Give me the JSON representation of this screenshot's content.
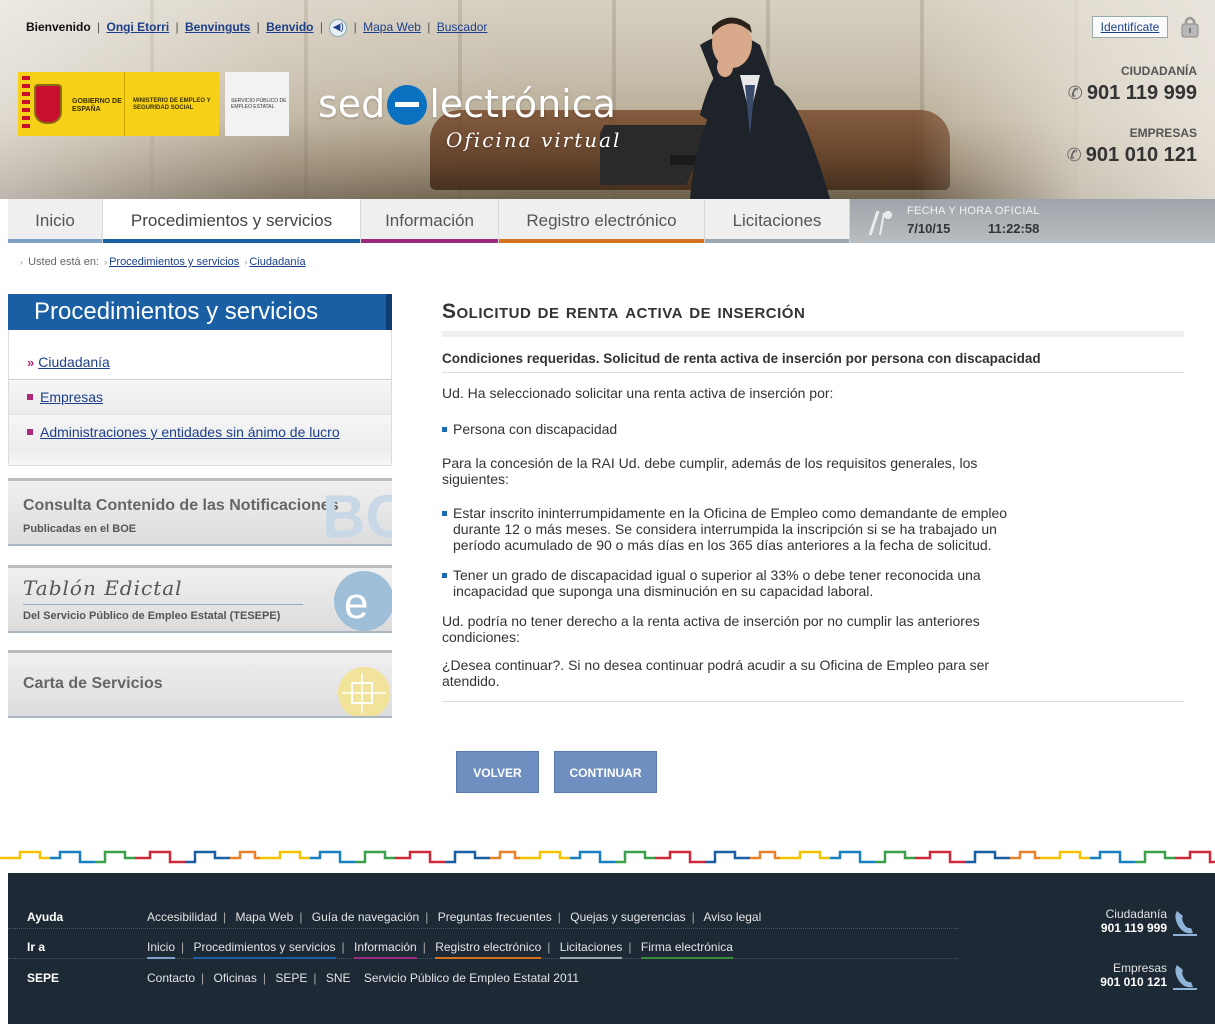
{
  "topnav": {
    "welcome": "Bienvenido",
    "langs": [
      "Ongi Etorri",
      "Benvinguts",
      "Benvido"
    ],
    "mapa": "Mapa Web",
    "buscador": "Buscador"
  },
  "logo": {
    "gobierno": "GOBIERNO DE ESPAÑA",
    "ministerio": "MINISTERIO DE EMPLEO Y SEGURIDAD SOCIAL",
    "sepe": "SERVICIO PÚBLICO DE EMPLEO ESTATAL",
    "sede_pre": "sed",
    "sede_post": "lectrónica",
    "subtitle": "Oficina virtual"
  },
  "header_right": {
    "identificate": "Identifícate",
    "ciudadania_label": "CIUDADANÍA",
    "ciudadania_phone": "901 119 999",
    "empresas_label": "EMPRESAS",
    "empresas_phone": "901 010 121"
  },
  "mainnav": {
    "tabs": [
      {
        "label": "Inicio",
        "color": "#7fa1c7"
      },
      {
        "label": "Procedimientos y servicios",
        "color": "#1a5ea4"
      },
      {
        "label": "Información",
        "color": "#9a2a7e"
      },
      {
        "label": "Registro electrónico",
        "color": "#d4711e"
      },
      {
        "label": "Licitaciones",
        "color": "#9aa6b0"
      }
    ],
    "fecha_label": "FECHA Y HORA OFICIAL",
    "fecha": "7/10/15",
    "hora": "11:22:58"
  },
  "breadcrumb": {
    "prefix": "Usted está en:",
    "items": [
      "Procedimientos y servicios",
      "Ciudadanía"
    ]
  },
  "sidebar": {
    "title": "Procedimientos y servicios",
    "items": [
      "Ciudadanía",
      "Empresas",
      "Administraciones y entidades sin ánimo de lucro"
    ],
    "boxes": {
      "notif_title": "Consulta Contenido de las Notificaciones",
      "notif_sub": "Publicadas en el BOE",
      "tablon_title": "Tablón Edictal",
      "tablon_sub": "Del Servicio Público de Empleo Estatal (TESEPE)",
      "carta_title": "Carta de Servicios"
    }
  },
  "content": {
    "title": "Solicitud de renta activa de inserción",
    "subhead": "Condiciones requeridas. Solicitud de renta activa de inserción por persona con discapacidad",
    "p1": "Ud. Ha seleccionado solicitar una renta activa de inserción por:",
    "b1": "Persona con discapacidad",
    "p2": "Para la concesión de la RAI Ud. debe cumplir, además de los requisitos generales, los siguientes:",
    "b2": "Estar inscrito ininterrumpidamente en la Oficina de Empleo como demandante de empleo durante 12 o más meses. Se considera interrumpida la inscripción si se ha trabajado un período acumulado de 90 o más días en los 365 días anteriores a la fecha de solicitud.",
    "b3": "Tener un grado de discapacidad igual o superior al 33% o debe tener reconocida una incapacidad que suponga una disminución en su capacidad laboral.",
    "p3": "Ud. podría no tener derecho a la renta activa de inserción por no cumplir las anteriores condiciones:",
    "p4": "¿Desea continuar?. Si no desea continuar podrá acudir a su Oficina de Empleo para ser atendido.",
    "btn_volver": "VOLVER",
    "btn_continuar": "CONTINUAR"
  },
  "footer": {
    "ayuda_head": "Ayuda",
    "ayuda_links": [
      "Accesibilidad",
      "Mapa Web",
      "Guía de navegación",
      "Preguntas frecuentes",
      "Quejas y sugerencias",
      "Aviso legal"
    ],
    "ira_head": "Ir a",
    "ira_links": [
      {
        "label": "Inicio",
        "color": "#7fa1c7"
      },
      {
        "label": "Procedimientos y servicios",
        "color": "#1a5ea4"
      },
      {
        "label": "Información",
        "color": "#9a2a7e"
      },
      {
        "label": "Registro electrónico",
        "color": "#d4711e"
      },
      {
        "label": "Licitaciones",
        "color": "#9aa6b0"
      },
      {
        "label": "Firma electrónica",
        "color": "#3a8a3a"
      }
    ],
    "sepe_head": "SEPE",
    "sepe_links": [
      "Contacto",
      "Oficinas",
      "SEPE",
      "SNE"
    ],
    "copyright": "Servicio Público de Empleo Estatal 2011",
    "ciudadania": "Ciudadanía",
    "ciudadania_phone": "901 119 999",
    "empresas": "Empresas",
    "empresas_phone": "901 010 121"
  }
}
